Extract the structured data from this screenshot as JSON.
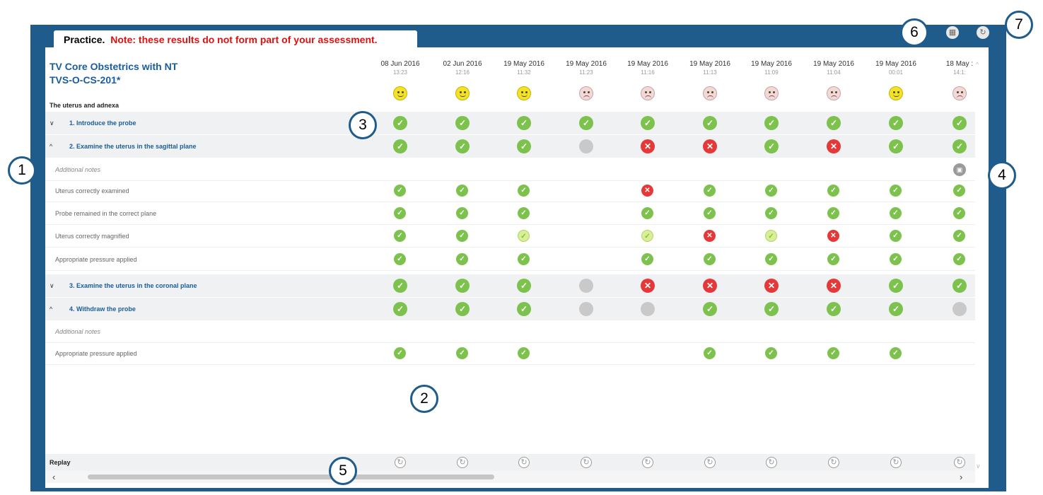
{
  "tab": {
    "label": "Practice.",
    "note": "Note: these results do not form part of your assessment."
  },
  "title": {
    "line1": "TV Core Obstetrics with NT",
    "line2": "TVS-O-CS-201*"
  },
  "section_label": "The uterus and adnexa",
  "columns": [
    {
      "date": "08 Jun 2016",
      "time": "13:23",
      "face": "happy"
    },
    {
      "date": "02 Jun 2016",
      "time": "12:16",
      "face": "happy"
    },
    {
      "date": "19 May 2016",
      "time": "11:32",
      "face": "happy"
    },
    {
      "date": "19 May 2016",
      "time": "11:23",
      "face": "sad"
    },
    {
      "date": "19 May 2016",
      "time": "11:16",
      "face": "sad"
    },
    {
      "date": "19 May 2016",
      "time": "11:13",
      "face": "sad"
    },
    {
      "date": "19 May 2016",
      "time": "11:09",
      "face": "sad"
    },
    {
      "date": "19 May 2016",
      "time": "11:04",
      "face": "sad"
    },
    {
      "date": "19 May 2016",
      "time": "00:01",
      "face": "happy"
    },
    {
      "date": "18 May :",
      "time": "14:1:",
      "face": "sad"
    }
  ],
  "rows": [
    {
      "type": "step",
      "chevron": "∨",
      "label": "1. Introduce the probe",
      "cells": [
        "pass",
        "pass",
        "pass",
        "pass",
        "pass",
        "pass",
        "pass",
        "pass",
        "pass",
        "pass"
      ]
    },
    {
      "type": "step",
      "chevron": "^",
      "label": "2. Examine the uterus in the sagittal plane",
      "cells": [
        "pass",
        "pass",
        "pass",
        "none",
        "fail",
        "fail",
        "pass",
        "fail",
        "pass",
        "pass"
      ]
    },
    {
      "type": "note",
      "label": "Additional notes",
      "cells": [
        "",
        "",
        "",
        "",
        "",
        "",
        "",
        "",
        "",
        "note"
      ]
    },
    {
      "type": "sub",
      "label": "Uterus correctly examined",
      "cells": [
        "pass",
        "pass",
        "pass",
        "",
        "fail",
        "pass",
        "pass",
        "pass",
        "pass",
        "pass"
      ]
    },
    {
      "type": "sub",
      "label": "Probe remained in the correct plane",
      "cells": [
        "pass",
        "pass",
        "pass",
        "",
        "pass",
        "pass",
        "pass",
        "pass",
        "pass",
        "pass"
      ]
    },
    {
      "type": "sub",
      "label": "Uterus correctly magnified",
      "cells": [
        "pass",
        "pass",
        "warn",
        "",
        "warn",
        "fail",
        "warn",
        "fail",
        "pass",
        "pass"
      ]
    },
    {
      "type": "sub",
      "label": "Appropriate pressure applied",
      "cells": [
        "pass",
        "pass",
        "pass",
        "",
        "pass",
        "pass",
        "pass",
        "pass",
        "pass",
        "pass"
      ]
    },
    {
      "type": "step",
      "chevron": "∨",
      "label": "3. Examine the uterus in the coronal plane",
      "cells": [
        "pass",
        "pass",
        "pass",
        "none",
        "fail",
        "fail",
        "fail",
        "fail",
        "pass",
        "pass"
      ]
    },
    {
      "type": "step",
      "chevron": "^",
      "label": "4. Withdraw the probe",
      "cells": [
        "pass",
        "pass",
        "pass",
        "none",
        "none",
        "pass",
        "pass",
        "pass",
        "pass",
        "none"
      ]
    },
    {
      "type": "note",
      "label": "Additional notes",
      "cells": [
        "",
        "",
        "",
        "",
        "",
        "",
        "",
        "",
        "",
        ""
      ]
    },
    {
      "type": "sub",
      "label": "Appropriate pressure applied",
      "cells": [
        "pass",
        "pass",
        "pass",
        "",
        "",
        "pass",
        "pass",
        "pass",
        "pass",
        ""
      ]
    }
  ],
  "replay_label": "Replay",
  "glyphs": {
    "pass": "✓",
    "fail": "✕",
    "warn": "✓",
    "note": "▣",
    "replay": "↻",
    "scroll_left": "‹",
    "scroll_right": "›",
    "scroll_up": "^",
    "scroll_down": "∨",
    "grid": "▦",
    "refresh": "↻"
  },
  "callouts": [
    "1",
    "2",
    "3",
    "4",
    "5",
    "6",
    "7"
  ],
  "colors": {
    "frame": "#1f5c8c",
    "title": "#1a5d9c",
    "note_text": "#e01010",
    "pass": "#7cc24d",
    "fail": "#e53838",
    "partial": "#d7ee9a",
    "not_done": "#c9c9c9",
    "happy_face": "#f4e226",
    "sad_face": "#f3d8d8"
  }
}
